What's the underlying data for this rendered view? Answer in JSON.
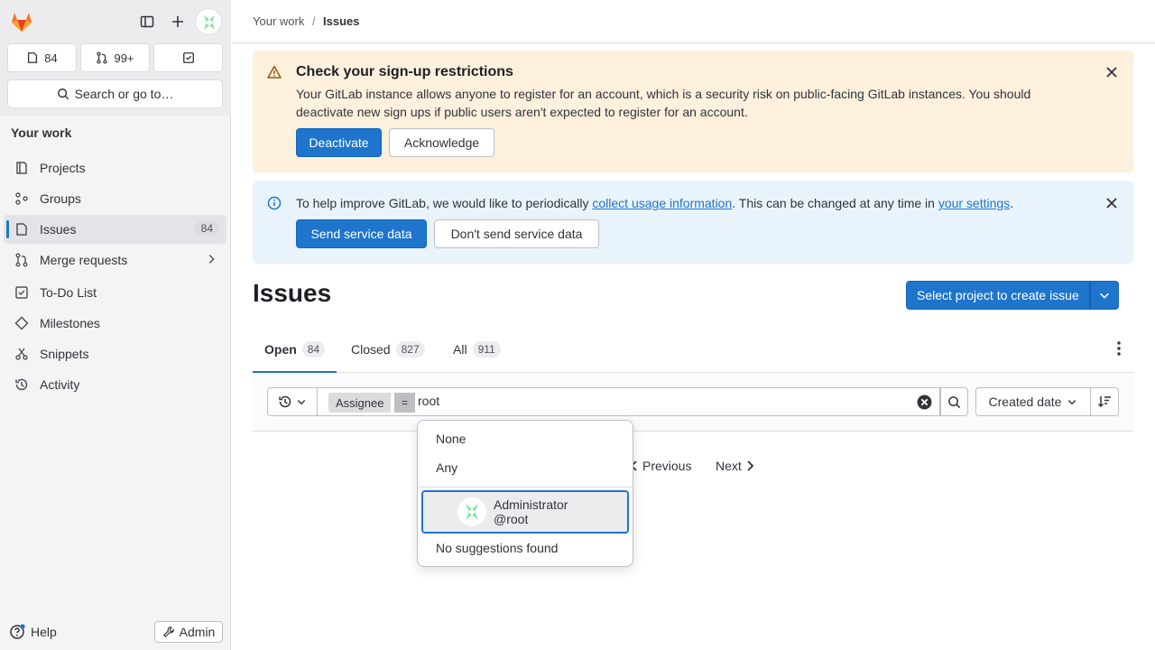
{
  "sidebar": {
    "issue_count": "84",
    "mr_count": "99+",
    "search_label": "Search or go to…",
    "section": "Your work",
    "items": [
      {
        "label": "Projects"
      },
      {
        "label": "Groups"
      },
      {
        "label": "Issues",
        "badge": "84"
      },
      {
        "label": "Merge requests"
      },
      {
        "label": "To-Do List"
      },
      {
        "label": "Milestones"
      },
      {
        "label": "Snippets"
      },
      {
        "label": "Activity"
      }
    ],
    "help_label": "Help",
    "admin_label": "Admin"
  },
  "breadcrumb": {
    "parent": "Your work",
    "separator": "/",
    "current": "Issues"
  },
  "alerts": {
    "signup": {
      "title": "Check your sign-up restrictions",
      "body": "Your GitLab instance allows anyone to register for an account, which is a security risk on public-facing GitLab instances. You should deactivate new sign ups if public users aren't expected to register for an account.",
      "primary": "Deactivate",
      "secondary": "Acknowledge"
    },
    "usage": {
      "text_1": "To help improve GitLab, we would like to periodically ",
      "link_1": "collect usage information",
      "text_2": ". This can be changed at any time in ",
      "link_2": "your settings",
      "text_3": ".",
      "primary": "Send service data",
      "secondary": "Don't send service data"
    }
  },
  "page": {
    "title": "Issues",
    "create_button": "Select project to create issue"
  },
  "tabs": [
    {
      "label": "Open",
      "count": "84"
    },
    {
      "label": "Closed",
      "count": "827"
    },
    {
      "label": "All",
      "count": "911"
    }
  ],
  "filter": {
    "token_name": "Assignee",
    "token_operator": "=",
    "token_value": "root",
    "sort_label": "Created date"
  },
  "pagination": {
    "previous": "Previous",
    "next": "Next"
  },
  "dropdown": {
    "none": "None",
    "any": "Any",
    "user_name": "Administrator",
    "user_handle": "@root",
    "empty_text": "No suggestions found"
  },
  "colors": {
    "primary": "#1f75cb",
    "warning_bg": "#fdf1dd",
    "info_bg": "#e9f3fc",
    "brand_orange": "#fc6d26"
  }
}
